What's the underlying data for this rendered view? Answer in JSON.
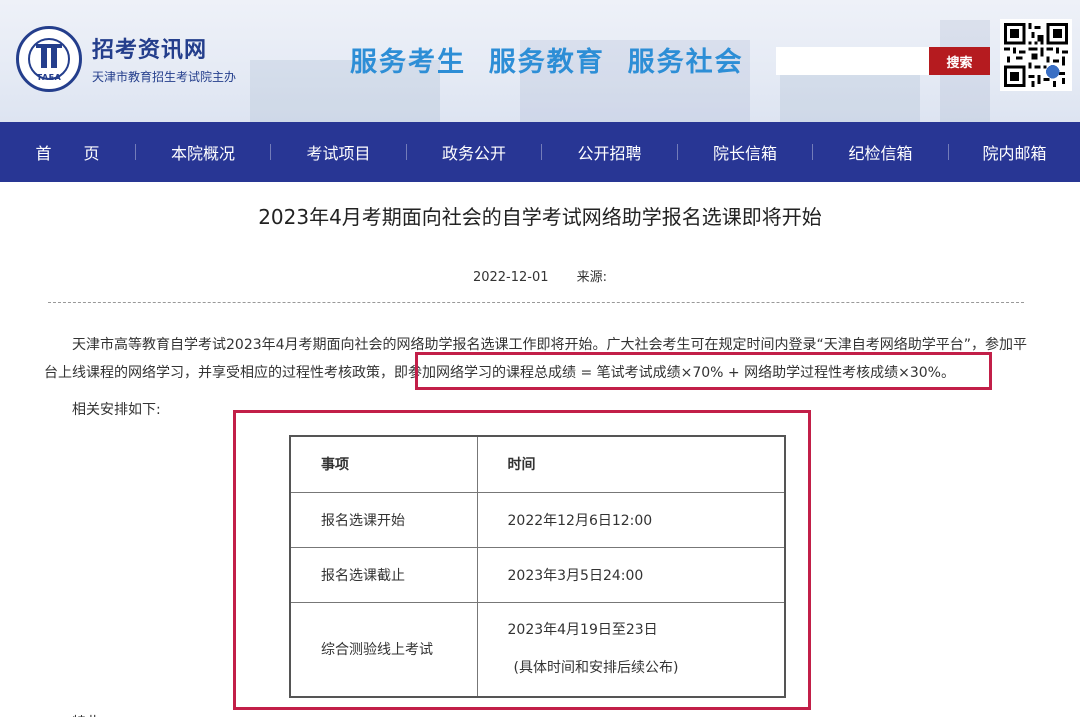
{
  "header": {
    "logo_title": "招考资讯网",
    "logo_subtitle": "天津市教育招生考试院主办",
    "logo_emblem_text": "TAEA",
    "slogan": "服务考生  服务教育  服务社会",
    "search_placeholder": "",
    "search_button": "搜索",
    "qr_icon": "qr-code-icon",
    "colors": {
      "brand": "#243e8c",
      "slogan": "#2d8ed6",
      "search_button": "#b51b1f"
    }
  },
  "nav": {
    "background": "#283694",
    "items": [
      {
        "label": "首　　页"
      },
      {
        "label": "本院概况"
      },
      {
        "label": "考试项目"
      },
      {
        "label": "政务公开"
      },
      {
        "label": "公开招聘"
      },
      {
        "label": "院长信箱"
      },
      {
        "label": "纪检信箱"
      },
      {
        "label": "院内邮箱"
      }
    ]
  },
  "article": {
    "title": "2023年4月考期面向社会的自学考试网络助学报名选课即将开始",
    "date": "2022-12-01",
    "source_label": "来源:",
    "paragraph_1a": "天津市高等教育自学考试2023年4月考期面向社会的网络助学报名选课工作即将开始。广大社会考生可在规定时间内登录“天津自考网络助学平台”，参加平台上线课程的网络学习，并享受相应的过程性考核政策，",
    "paragraph_1b": "即参加网络学习的课程总成绩 = 笔试考试成绩×70% + 网络助学过程性考核成绩×30%。",
    "paragraph_2": "相关安排如下:",
    "trailing_text": "特此",
    "highlight_color": "#c21f48",
    "table": {
      "headers": [
        "事项",
        "时间"
      ],
      "rows": [
        {
          "item": "报名选课开始",
          "time": "2022年12月6日12:00"
        },
        {
          "item": "报名选课截止",
          "time": "2023年3月5日24:00"
        },
        {
          "item": "综合测验线上考试",
          "time": "2023年4月19日至23日",
          "note": "(具体时间和安排后续公布)"
        }
      ]
    }
  }
}
